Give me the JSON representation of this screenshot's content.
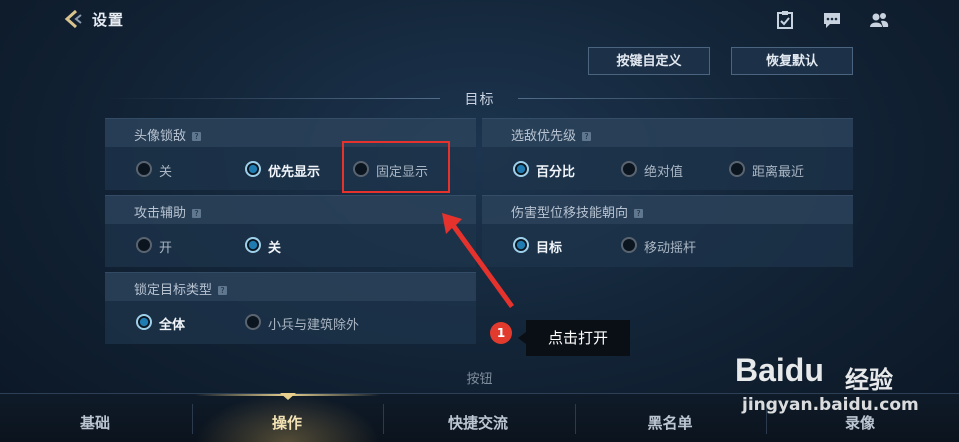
{
  "header": {
    "title": "设置",
    "icons": [
      "back-chevron-icon",
      "clipboard-icon",
      "chat-icon",
      "friends-icon"
    ]
  },
  "actions": {
    "custom_keys": "按键自定义",
    "restore_default": "恢复默认"
  },
  "section_target": "目标",
  "panels": {
    "avatar_lock": {
      "title": "头像锁敌",
      "help": "?",
      "options": [
        "关",
        "优先显示",
        "固定显示"
      ],
      "selected": "优先显示"
    },
    "target_priority": {
      "title": "选敌优先级",
      "help": "?",
      "options": [
        "百分比",
        "绝对值",
        "距离最近"
      ],
      "selected": "百分比"
    },
    "attack_assist": {
      "title": "攻击辅助",
      "help": "?",
      "options": [
        "开",
        "关"
      ],
      "selected": "关"
    },
    "damage_skill_direction": {
      "title": "伤害型位移技能朝向",
      "help": "?",
      "options": [
        "目标",
        "移动摇杆"
      ],
      "selected": "目标"
    },
    "lock_target_type": {
      "title": "锁定目标类型",
      "help": "?",
      "options": [
        "全体",
        "小兵与建筑除外"
      ],
      "selected": "全体"
    }
  },
  "annotation": {
    "step": "1",
    "tip": "点击打开",
    "accent": "#e5322d"
  },
  "section_buttons": "按钮",
  "tabs": [
    "基础",
    "操作",
    "快捷交流",
    "黑名单",
    "录像"
  ],
  "active_tab": "操作",
  "watermark": {
    "logo": "Baidu",
    "brand": "经验",
    "url": "jingyan.baidu.com"
  },
  "colors": {
    "active_tab": "#f3e3b5",
    "radio_on": "#1f7bb0"
  }
}
